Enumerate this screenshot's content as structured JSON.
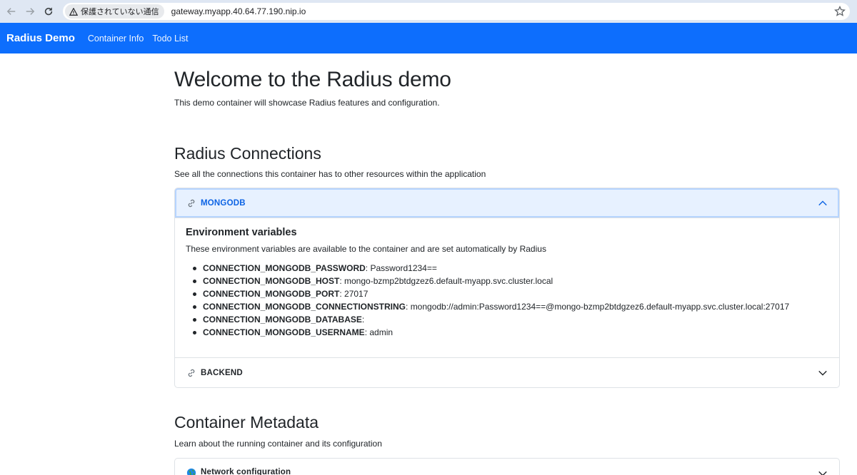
{
  "browser": {
    "security_label": "保護されていない通信",
    "url": "gateway.myapp.40.64.77.190.nip.io"
  },
  "navbar": {
    "brand": "Radius Demo",
    "links": [
      "Container Info",
      "Todo List"
    ]
  },
  "welcome": {
    "title": "Welcome to the Radius demo",
    "subtitle": "This demo container will showcase Radius features and configuration."
  },
  "connections": {
    "title": "Radius Connections",
    "subtitle": "See all the connections this container has to other resources within the application",
    "items": [
      {
        "name": "MONGODB",
        "expanded": true,
        "body_title": "Environment variables",
        "body_desc": "These environment variables are available to the container and are set automatically by Radius",
        "env": [
          {
            "key": "CONNECTION_MONGODB_PASSWORD",
            "value": "Password1234=="
          },
          {
            "key": "CONNECTION_MONGODB_HOST",
            "value": "mongo-bzmp2btdgzez6.default-myapp.svc.cluster.local"
          },
          {
            "key": "CONNECTION_MONGODB_PORT",
            "value": "27017"
          },
          {
            "key": "CONNECTION_MONGODB_CONNECTIONSTRING",
            "value": "mongodb://admin:Password1234==@mongo-bzmp2btdgzez6.default-myapp.svc.cluster.local:27017"
          },
          {
            "key": "CONNECTION_MONGODB_DATABASE",
            "value": ""
          },
          {
            "key": "CONNECTION_MONGODB_USERNAME",
            "value": "admin"
          }
        ]
      },
      {
        "name": "BACKEND",
        "expanded": false
      }
    ]
  },
  "metadata": {
    "title": "Container Metadata",
    "subtitle": "Learn about the running container and its configuration",
    "items": [
      {
        "name": "Network configuration",
        "expanded": false
      }
    ]
  },
  "colors": {
    "primary": "#0d6efd",
    "accordion_active_bg": "#e7f1ff",
    "accordion_active_text": "#0c63e4"
  }
}
